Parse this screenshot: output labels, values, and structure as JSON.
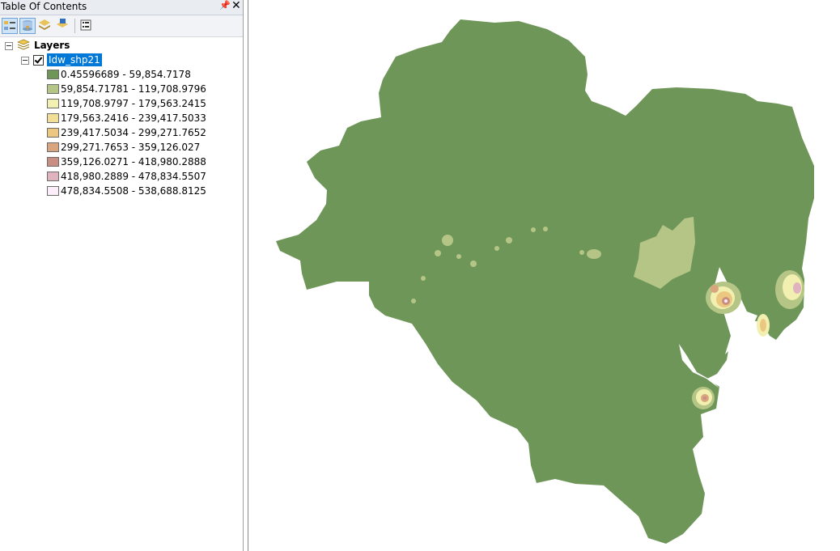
{
  "toc": {
    "title": "Table Of Contents",
    "pin_icon": "pin-icon",
    "close_glyph": "✕",
    "toolbar": [
      "list-by-drawing-order-icon",
      "list-by-source-icon",
      "list-by-visibility-icon",
      "list-by-selection-icon",
      "options-icon"
    ],
    "root_label": "Layers",
    "layer": {
      "name": "Idw_shp21",
      "checked": true,
      "legend": [
        {
          "label": "0.45596689 - 59,854.7178",
          "color": "#6f9659"
        },
        {
          "label": "59,854.71781 - 119,708.9796",
          "color": "#b4c586"
        },
        {
          "label": "119,708.9797 - 179,563.2415",
          "color": "#f2f0b0"
        },
        {
          "label": "179,563.2416 - 239,417.5033",
          "color": "#f1df98"
        },
        {
          "label": "239,417.5034 - 299,271.7652",
          "color": "#ecc77f"
        },
        {
          "label": "299,271.7653 - 359,126.027",
          "color": "#d9a57e"
        },
        {
          "label": "359,126.0271 - 418,980.2888",
          "color": "#c98e82"
        },
        {
          "label": "418,980.2889 - 478,834.5507",
          "color": "#e0b4bf"
        },
        {
          "label": "478,834.5508 - 538,688.8125",
          "color": "#fbeefa"
        }
      ]
    }
  }
}
